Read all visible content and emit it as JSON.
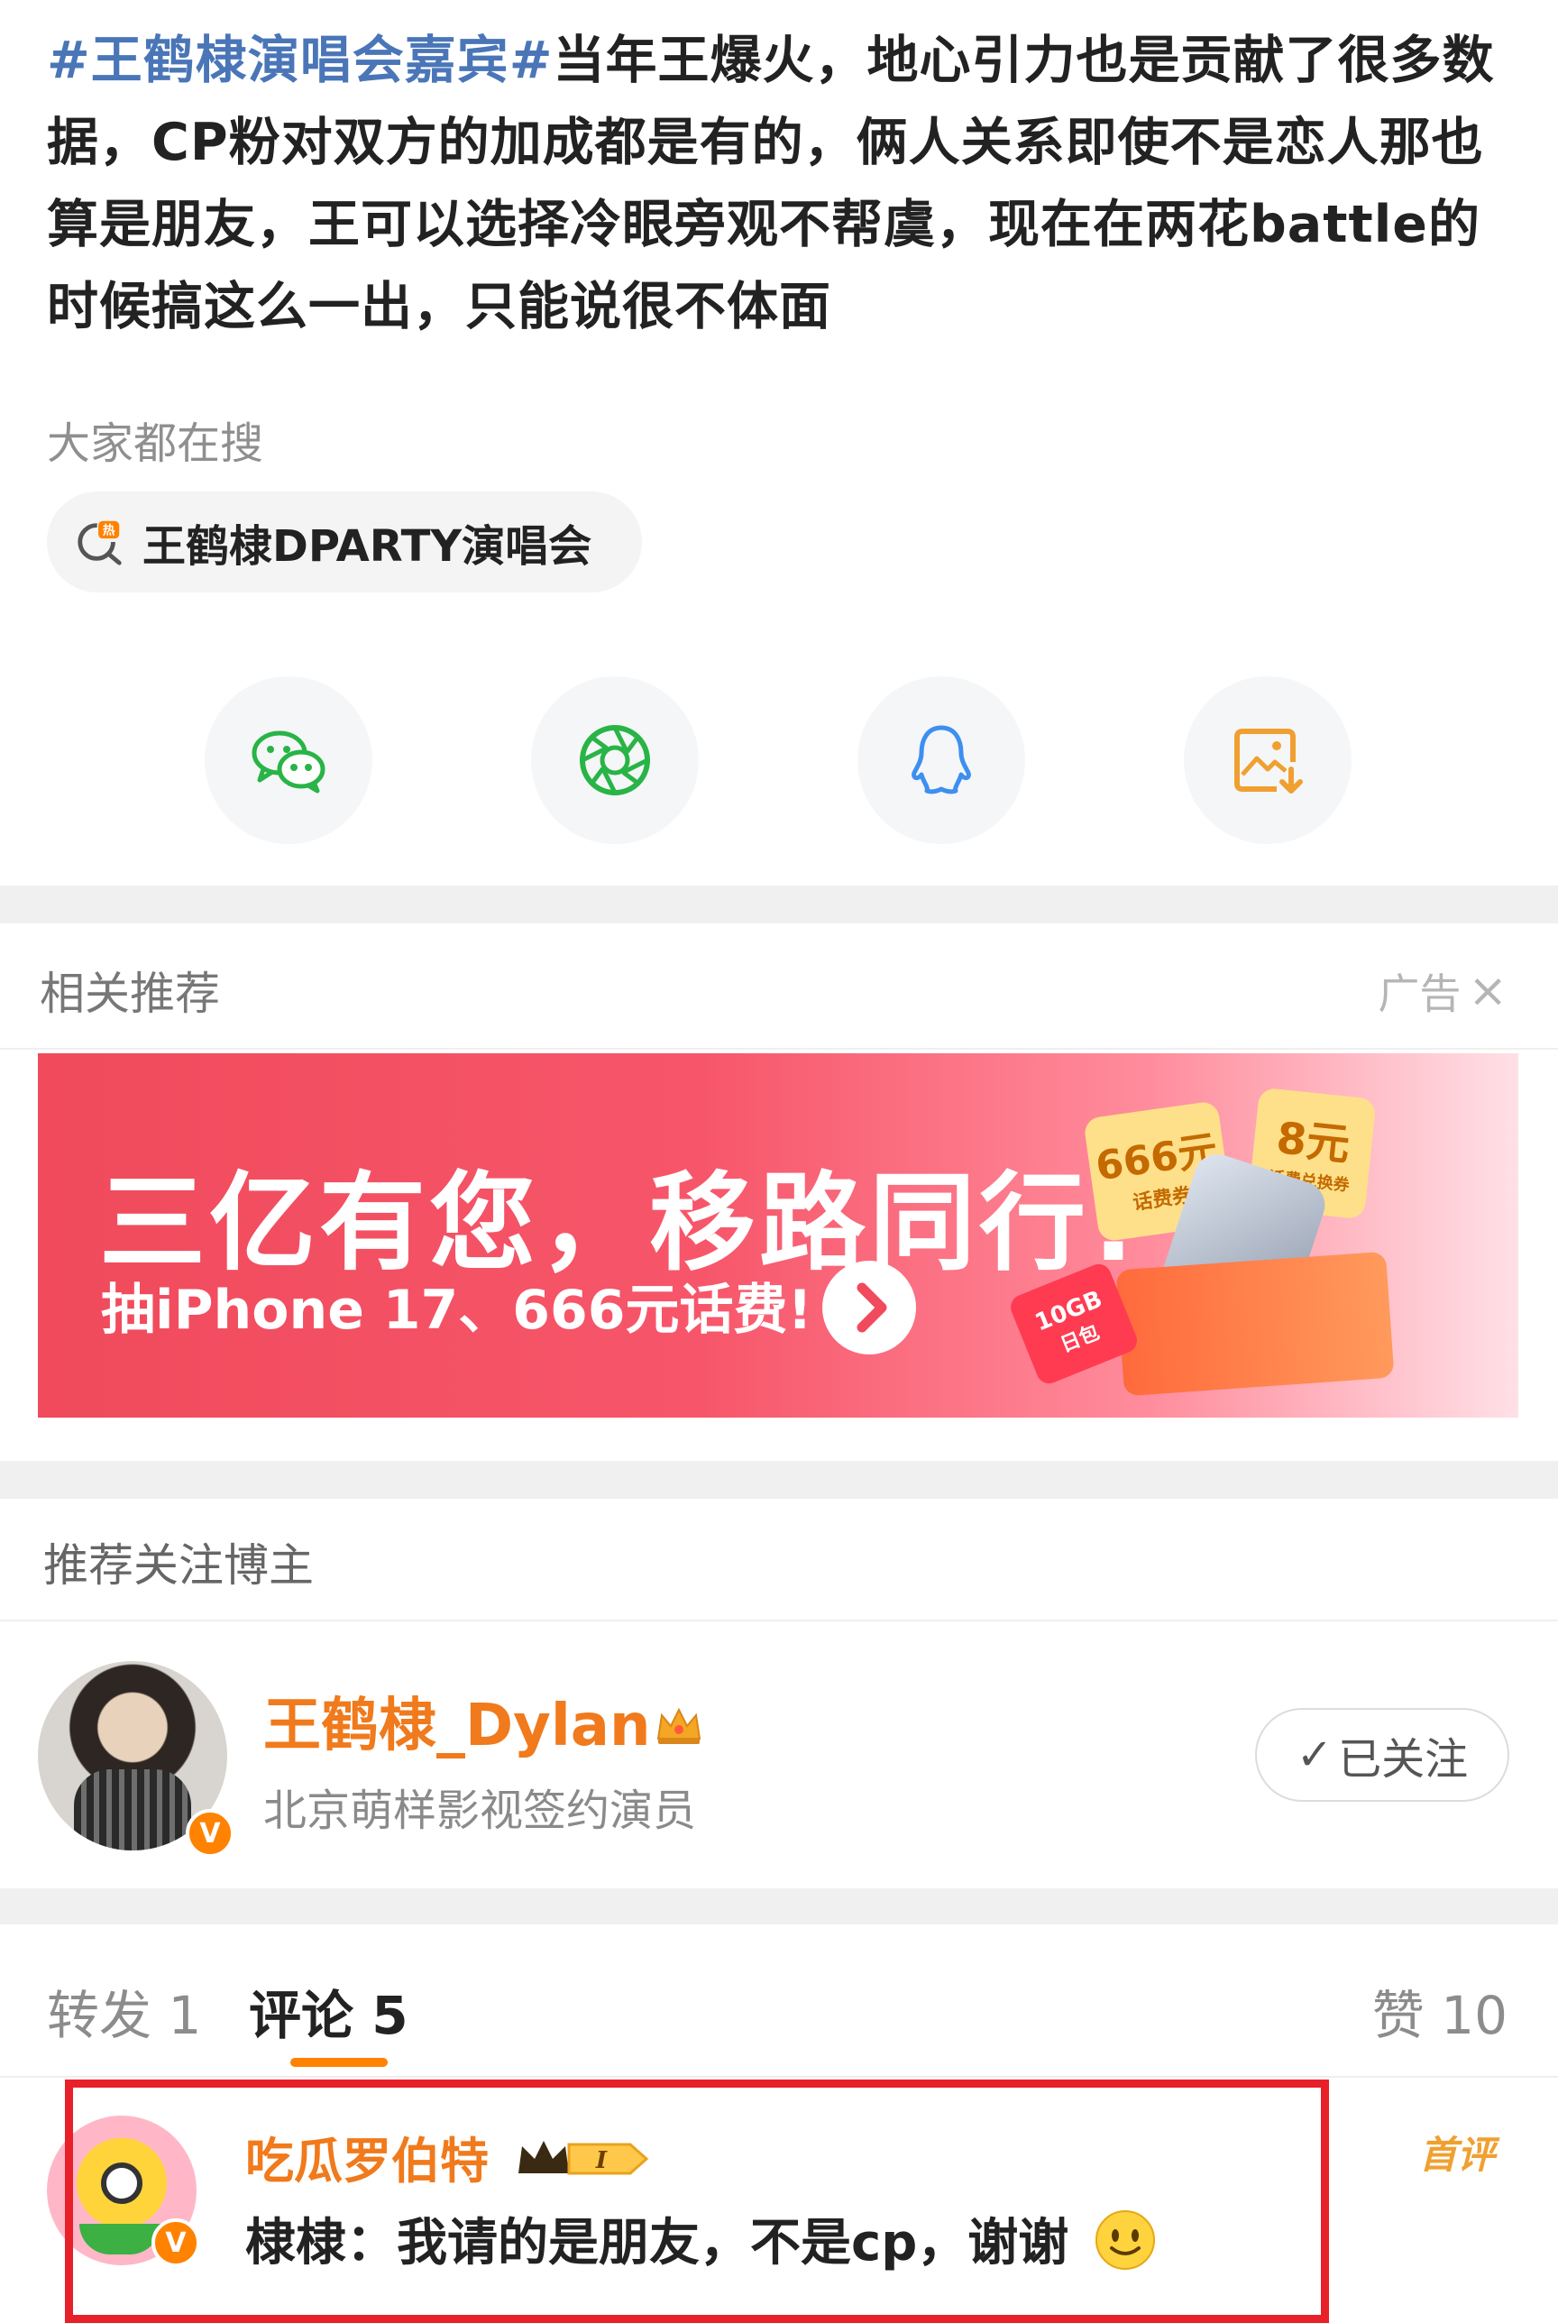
{
  "post": {
    "hashtag": "#王鹤棣演唱会嘉宾#",
    "text": "当年王爆火，地心引力也是贡献了很多数据，CP粉对双方的加成都是有的，俩人关系即使不是恋人那也算是朋友，王可以选择冷眼旁观不帮虞，现在在两花battle的时候搞这么一出，只能说很不体面"
  },
  "trending": {
    "caption": "大家都在搜",
    "query": "王鹤棣DPARTY演唱会",
    "icon": "hot-search-icon"
  },
  "share": [
    {
      "name": "wechat",
      "icon": "wechat-icon",
      "color": "#28b446"
    },
    {
      "name": "moments",
      "icon": "moments-icon",
      "color": "#28b446"
    },
    {
      "name": "qq",
      "icon": "qq-icon",
      "color": "#3d8ff0"
    },
    {
      "name": "save-image",
      "icon": "save-image-icon",
      "color": "#f0a030"
    }
  ],
  "related": {
    "title": "相关推荐",
    "ad_label": "广告",
    "close": "×"
  },
  "banner": {
    "headline": "三亿有您，移路同行!",
    "subline": "抽iPhone 17、666元话费!",
    "prize1": "666元",
    "prize1_note": "话费券",
    "prize2": "8元",
    "prize2_note": "话费兑换券",
    "data_tag": "10GB",
    "data_tag_note": "日包"
  },
  "recommend": {
    "title": "推荐关注博主",
    "blogger_name": "王鹤棣_Dylan",
    "blogger_desc": "北京萌样影视签约演员",
    "follow_label": "已关注",
    "verified_badge": "V"
  },
  "tabs": {
    "repost_label": "转发",
    "repost_count": "1",
    "comment_label": "评论",
    "comment_count": "5",
    "like_label": "赞",
    "like_count": "10"
  },
  "comment": {
    "user": "吃瓜罗伯特",
    "level": "I",
    "text": "棣棣：我请的是朋友，不是cp，谢谢",
    "first_tag": "首评"
  },
  "colors": {
    "accent": "#ff8200",
    "name_orange": "#f07a1c",
    "link_blue": "#4a76b8",
    "highlight_red": "#e8202a"
  }
}
